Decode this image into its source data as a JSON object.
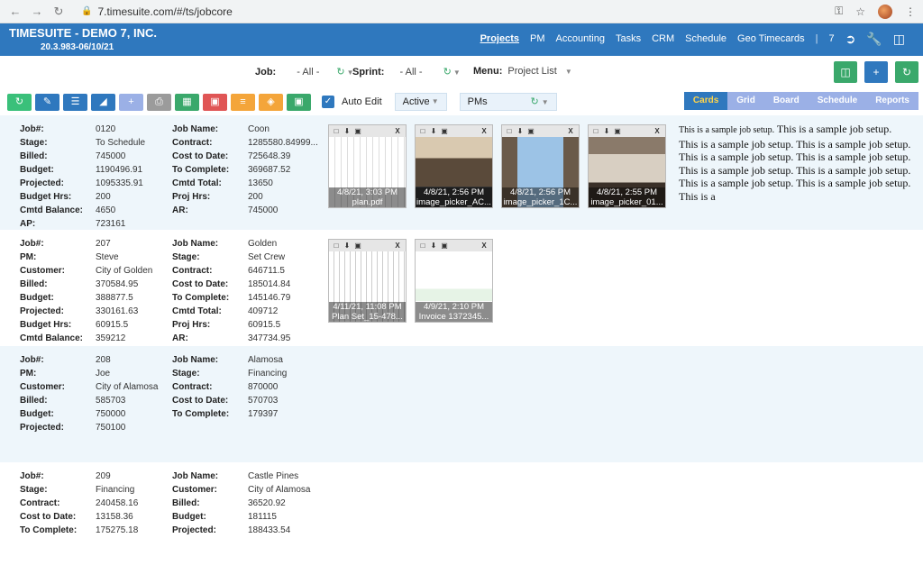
{
  "browser": {
    "url": "7.timesuite.com/#/ts/jobcore"
  },
  "app": {
    "title": "TIMESUITE - DEMO 7, INC.",
    "version": "20.3.983-06/10/21",
    "nav": [
      "Projects",
      "PM",
      "Accounting",
      "Tasks",
      "CRM",
      "Schedule",
      "Geo Timecards"
    ],
    "nav_count": "7"
  },
  "filters": {
    "job_label": "Job:",
    "job_value": "- All -",
    "sprint_label": "Sprint:",
    "sprint_value": "- All -",
    "menu_label": "Menu:",
    "menu_value": "Project List"
  },
  "toolbar": {
    "auto_edit": "Auto Edit",
    "status": "Active",
    "pms": "PMs",
    "views": [
      "Cards",
      "Grid",
      "Board",
      "Schedule",
      "Reports"
    ]
  },
  "colors": {
    "brand": "#2f78be",
    "green": "#3aa86b",
    "red": "#e05555",
    "orange": "#f4a53a",
    "lavender": "#9bb0e6",
    "alt_row": "#eef6fb"
  },
  "jobs": [
    {
      "left": [
        [
          "Job#:",
          "0120"
        ],
        [
          "Stage:",
          "To Schedule"
        ],
        [
          "Billed:",
          "745000"
        ],
        [
          "Budget:",
          "1190496.91"
        ],
        [
          "Projected:",
          "1095335.91"
        ],
        [
          "Budget Hrs:",
          "200"
        ],
        [
          "Cmtd Balance:",
          "4650"
        ],
        [
          "AP:",
          "723161"
        ]
      ],
      "right": [
        [
          "Job Name:",
          "Coon"
        ],
        [
          "Contract:",
          "1285580.84999..."
        ],
        [
          "Cost to Date:",
          "725648.39"
        ],
        [
          "To Complete:",
          "369687.52"
        ],
        [
          "Cmtd Total:",
          "13650"
        ],
        [
          "Proj Hrs:",
          "200"
        ],
        [
          "AR:",
          "745000"
        ]
      ],
      "attachments": [
        {
          "date": "4/8/21, 3:03 PM",
          "name": "plan.pdf"
        },
        {
          "date": "4/8/21, 2:56 PM",
          "name": "image_picker_AC..."
        },
        {
          "date": "4/8/21, 2:56 PM",
          "name": "image_picker_1C..."
        },
        {
          "date": "4/8/21, 2:55 PM",
          "name": "image_picker_01..."
        }
      ],
      "description_first": "This is a sample job setup.",
      "description_rest": "This is a sample job setup. This is a sample job setup. This is a sample job setup. This is a sample job setup. This is a sample job setup. This is a sample job setup. This is a sample job setup. This is a sample job setup. This is a sample job setup. This is a"
    },
    {
      "left": [
        [
          "Job#:",
          "207"
        ],
        [
          "PM:",
          "Steve"
        ],
        [
          "Customer:",
          "City of Golden"
        ],
        [
          "Billed:",
          "370584.95"
        ],
        [
          "Budget:",
          "388877.5"
        ],
        [
          "Projected:",
          "330161.63"
        ],
        [
          "Budget Hrs:",
          "60915.5"
        ],
        [
          "Cmtd Balance:",
          "359212"
        ]
      ],
      "right": [
        [
          "Job Name:",
          "Golden"
        ],
        [
          "Stage:",
          "Set Crew"
        ],
        [
          "Contract:",
          "646711.5"
        ],
        [
          "Cost to Date:",
          "185014.84"
        ],
        [
          "To Complete:",
          "145146.79"
        ],
        [
          "Cmtd Total:",
          "409712"
        ],
        [
          "Proj Hrs:",
          "60915.5"
        ],
        [
          "AR:",
          "347734.95"
        ]
      ],
      "attachments": [
        {
          "date": "4/11/21, 11:08 PM",
          "name": "Plan Set_15-478..."
        },
        {
          "date": "4/9/21, 2:10 PM",
          "name": "Invoice 1372345..."
        }
      ]
    },
    {
      "left": [
        [
          "Job#:",
          "208"
        ],
        [
          "PM:",
          "Joe"
        ],
        [
          "Customer:",
          "City of Alamosa"
        ],
        [
          "Billed:",
          "585703"
        ],
        [
          "Budget:",
          "750000"
        ],
        [
          "Projected:",
          "750100"
        ]
      ],
      "right": [
        [
          "Job Name:",
          "Alamosa"
        ],
        [
          "Stage:",
          "Financing"
        ],
        [
          "Contract:",
          "870000"
        ],
        [
          "Cost to Date:",
          "570703"
        ],
        [
          "To Complete:",
          "179397"
        ]
      ]
    },
    {
      "left": [
        [
          "Job#:",
          "209"
        ],
        [
          "Stage:",
          "Financing"
        ],
        [
          "Contract:",
          "240458.16"
        ],
        [
          "Cost to Date:",
          "13158.36"
        ],
        [
          "To Complete:",
          "175275.18"
        ]
      ],
      "right": [
        [
          "Job Name:",
          "Castle Pines"
        ],
        [
          "Customer:",
          "City of Alamosa"
        ],
        [
          "Billed:",
          "36520.92"
        ],
        [
          "Budget:",
          "181115"
        ],
        [
          "Projected:",
          "188433.54"
        ]
      ]
    }
  ]
}
